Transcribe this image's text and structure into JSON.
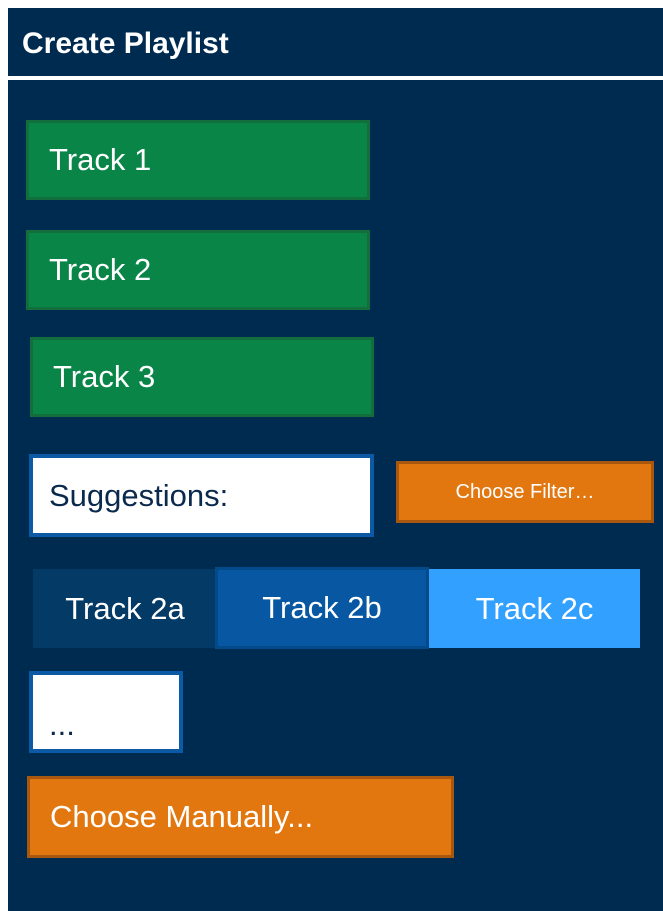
{
  "window": {
    "title": "Create Playlist"
  },
  "playlist": {
    "tracks": [
      "Track 1",
      "Track 2",
      "Track 3"
    ]
  },
  "suggestions": {
    "label": "Suggestions:",
    "filter_button": "Choose Filter…",
    "items": [
      "Track 2a",
      "Track 2b",
      "Track 2c"
    ],
    "more": "..."
  },
  "actions": {
    "choose_manually": "Choose Manually..."
  },
  "colors": {
    "background": "#002b50",
    "track": "#0a8548",
    "accent_orange": "#e2760f",
    "suggestion_a": "#033a66",
    "suggestion_b": "#0757a2",
    "suggestion_c": "#31a0ff"
  }
}
